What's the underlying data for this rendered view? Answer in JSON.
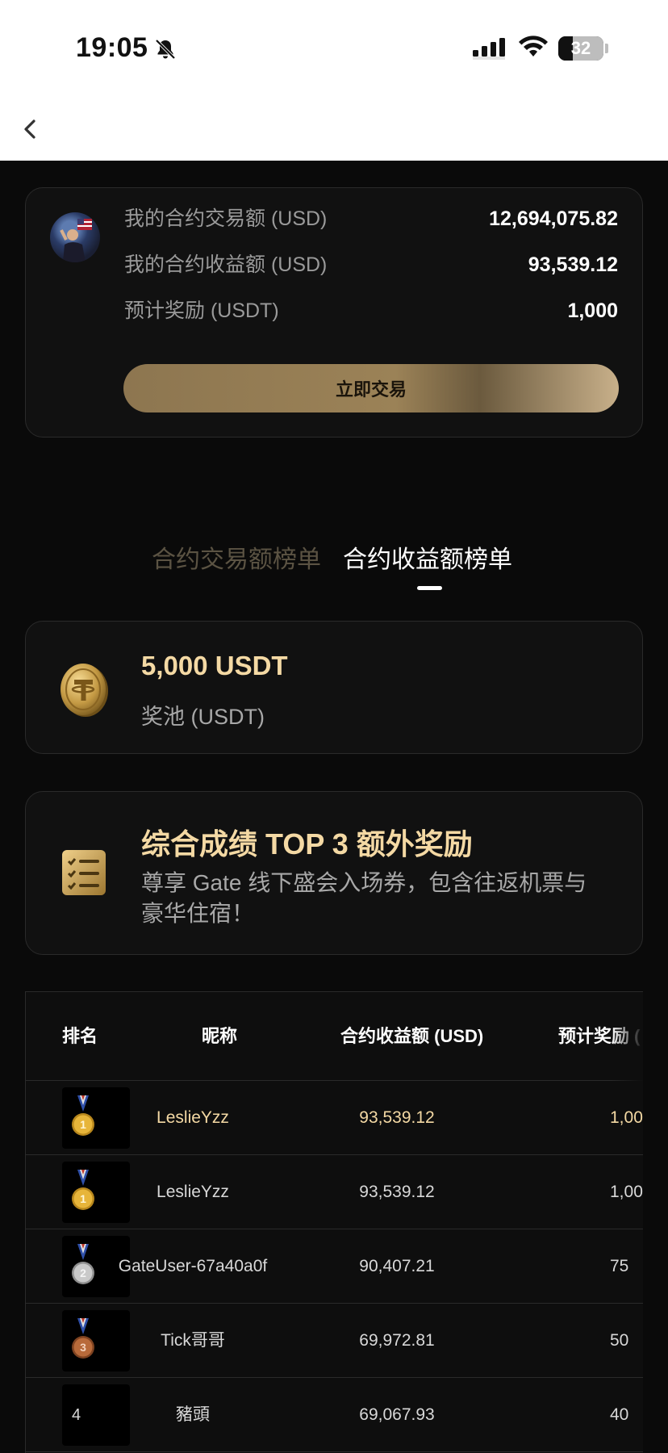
{
  "status_bar": {
    "time": "19:05",
    "battery": "32"
  },
  "summary": {
    "rows": [
      {
        "label": "我的合约交易额 (USD)",
        "value": "12,694,075.82"
      },
      {
        "label": "我的合约收益额 (USD)",
        "value": "93,539.12"
      },
      {
        "label": "预计奖励 (USDT)",
        "value": "1,000"
      }
    ],
    "trade_button": "立即交易"
  },
  "tabs": [
    {
      "label": "合约交易额榜单",
      "active": false
    },
    {
      "label": "合约收益额榜单",
      "active": true
    }
  ],
  "pool": {
    "amount": "5,000 USDT",
    "label": "奖池 (USDT)"
  },
  "bonus": {
    "title": "综合成绩 TOP 3 额外奖励",
    "description": "尊享 Gate 线下盛会入场券，包含往返机票与豪华住宿！"
  },
  "table": {
    "headers": [
      "排名",
      "昵称",
      "合约收益额 (USD)",
      "预计奖励 ("
    ],
    "rows": [
      {
        "rank": "1",
        "medal": "gold",
        "nickname": "LeslieYzz",
        "profit": "93,539.12",
        "reward": "1,00",
        "highlight": true
      },
      {
        "rank": "1",
        "medal": "gold",
        "nickname": "LeslieYzz",
        "profit": "93,539.12",
        "reward": "1,00",
        "highlight": false
      },
      {
        "rank": "2",
        "medal": "silver",
        "nickname": "GateUser-67a40a0f",
        "profit": "90,407.21",
        "reward": "75",
        "highlight": false
      },
      {
        "rank": "3",
        "medal": "bronze",
        "nickname": "Tick哥哥",
        "profit": "69,972.81",
        "reward": "50",
        "highlight": false
      },
      {
        "rank": "4",
        "medal": "",
        "nickname": "豬頭",
        "profit": "69,067.93",
        "reward": "40",
        "highlight": false
      }
    ]
  },
  "colors": {
    "accent_gold": "#f4d9a4",
    "background": "#0a0a0a",
    "card": "#111111",
    "muted_text": "#9a9a9a"
  }
}
